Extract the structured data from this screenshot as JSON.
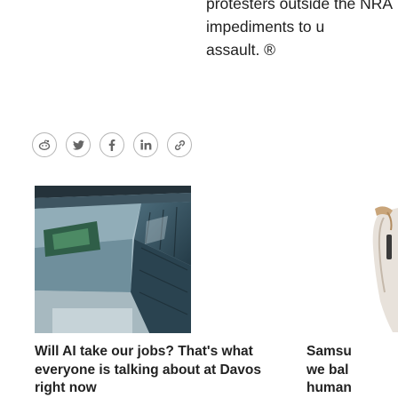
{
  "intro_text": {
    "lines": [
      "protesters outside the NRA",
      "impediments to u",
      "assault. ®"
    ]
  },
  "share": {
    "buttons": [
      {
        "icon": "reddit-icon"
      },
      {
        "icon": "twitter-icon"
      },
      {
        "icon": "facebook-icon"
      },
      {
        "icon": "linkedin-icon"
      },
      {
        "icon": "link-icon"
      }
    ]
  },
  "cards": [
    {
      "title_lines": [
        "Will AI take our jobs? That's what",
        "everyone is talking about at Davos",
        "right now"
      ]
    },
    {
      "title_lines": [
        "Samsu",
        "we bal",
        "human"
      ]
    }
  ],
  "colors": {
    "text": "#1f1f1f",
    "icon_border": "#b5b5b5",
    "icon": "#666666"
  }
}
